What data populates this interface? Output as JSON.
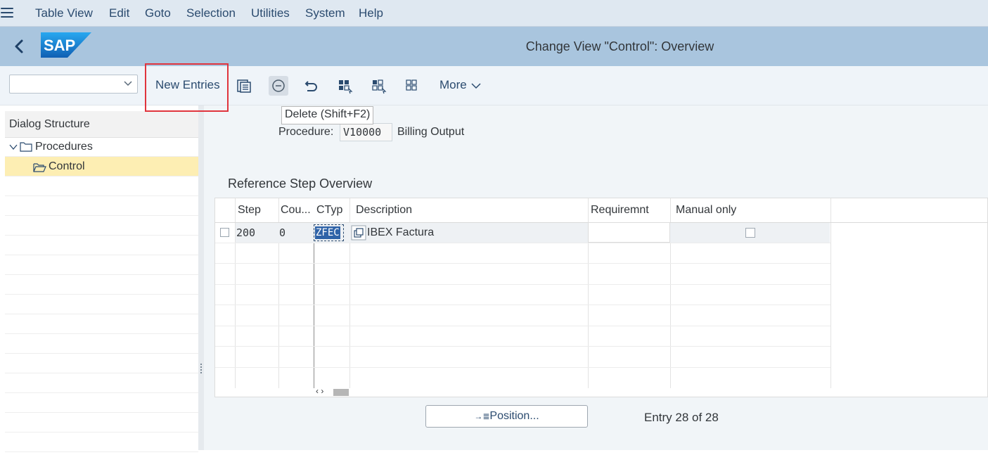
{
  "menu": {
    "items": [
      "Table View",
      "Edit",
      "Goto",
      "Selection",
      "Utilities",
      "System",
      "Help"
    ]
  },
  "titlebar": {
    "logo_text": "SAP",
    "title": "Change View \"Control\": Overview"
  },
  "toolbar": {
    "new_entries": "New Entries",
    "more": "More",
    "icons": [
      "details-icon",
      "delete-icon",
      "undo-icon",
      "select-all-icon",
      "select-block-icon",
      "deselect-all-icon"
    ]
  },
  "tooltip": {
    "text": "Delete   (Shift+F2)"
  },
  "dialog_structure": {
    "title": "Dialog Structure",
    "items": [
      {
        "label": "Procedures",
        "selected": false
      },
      {
        "label": "Control",
        "selected": true
      }
    ]
  },
  "procedure": {
    "label": "Procedure:",
    "value": "V10000",
    "description": "Billing Output"
  },
  "table": {
    "title": "Reference Step Overview",
    "columns": [
      "Step",
      "Cou...",
      "CTyp",
      "Description",
      "Requiremnt",
      "Manual only"
    ],
    "rows": [
      {
        "step": "200",
        "counter": "0",
        "ctyp": "ZFEC",
        "description": "IBEX Factura",
        "requirement": "",
        "manual_only": false
      }
    ]
  },
  "footer": {
    "position_button": "Position...",
    "entry_count": "Entry 28 of 28"
  },
  "colors": {
    "menubar": "#dfe8f1",
    "titlebar": "#a9c5de",
    "toolbar": "#eff4f9",
    "selected_row": "#fdeeb3",
    "highlight": "#e0343d",
    "sap_blue": "#1a73c8"
  }
}
